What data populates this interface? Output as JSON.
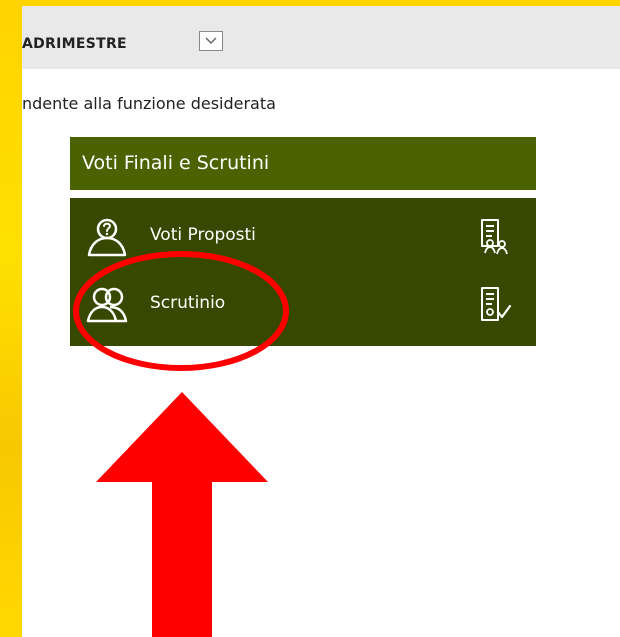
{
  "period": {
    "label": "ADRIMESTRE",
    "selector_icon": "chevron-down-icon"
  },
  "instruction": "ndente alla funzione desiderata",
  "section": {
    "title": "Voti Finali e Scrutini",
    "items": [
      {
        "label": "Voti Proposti",
        "icon": "user-question-icon",
        "action_icon": "document-users-icon"
      },
      {
        "label": "Scrutinio",
        "icon": "group-icon",
        "action_icon": "document-check-icon"
      }
    ]
  },
  "colors": {
    "header_green": "#4a6200",
    "panel_green": "#374800",
    "accent_yellow": "#ffd400",
    "annotation_red": "#ff0000"
  }
}
